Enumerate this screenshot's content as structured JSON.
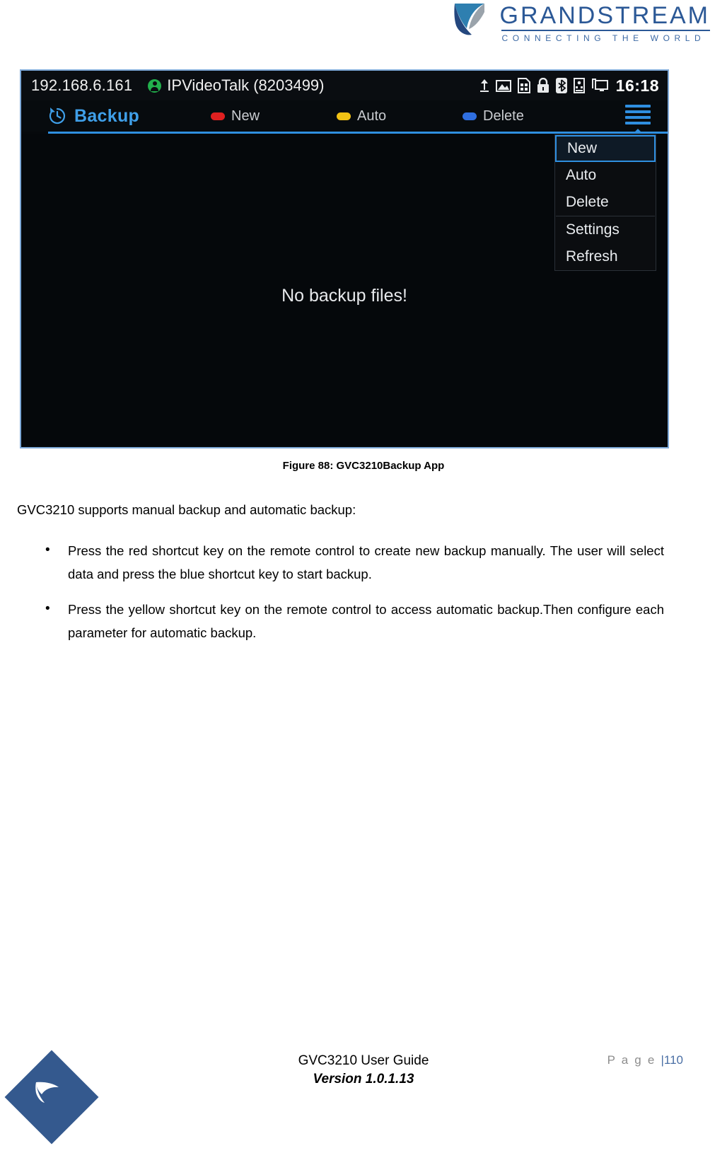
{
  "brand": {
    "name": "GRANDSTREAM",
    "tagline": "CONNECTING THE WORLD",
    "logo_icon": "grandstream-swoosh-icon",
    "primary_color": "#2b5896"
  },
  "screenshot": {
    "status_bar": {
      "ip_address": "192.168.6.161",
      "account_icon": "account-contact-icon",
      "account_label": "IPVideoTalk (8203499)",
      "icons": [
        "upload-icon",
        "picture-icon",
        "sd-card-icon",
        "lock-icon",
        "bluetooth-icon",
        "sim-card-icon",
        "display-monitor-icon"
      ],
      "clock": "16:18"
    },
    "app_bar": {
      "title_icon": "backup-restore-clock-icon",
      "title": "Backup",
      "softkeys": [
        {
          "label": "New",
          "color": "#e02020",
          "key": "red"
        },
        {
          "label": "Auto",
          "color": "#f2c214",
          "key": "yellow"
        },
        {
          "label": "Delete",
          "color": "#2f6fe0",
          "key": "blue"
        }
      ],
      "menu_icon": "hamburger-menu-icon"
    },
    "dropdown_menu": {
      "items": [
        {
          "label": "New",
          "selected": true
        },
        {
          "label": "Auto",
          "selected": false
        },
        {
          "label": "Delete",
          "selected": false
        },
        {
          "label": "Settings",
          "selected": false
        },
        {
          "label": "Refresh",
          "selected": false
        }
      ],
      "separator_after_index": 2
    },
    "content": {
      "empty_message": "No backup files!"
    },
    "accent_color": "#2f8fe0"
  },
  "figure": {
    "caption": "Figure 88: GVC3210Backup App"
  },
  "body": {
    "intro": "GVC3210 supports manual backup and automatic backup:",
    "bullets": [
      "Press the red shortcut key on the remote control to create new backup manually. The user will select data and press the blue shortcut key to start backup.",
      "Press the yellow shortcut key on the remote control to access automatic backup.Then configure each parameter for automatic backup."
    ]
  },
  "footer": {
    "guide_title": "GVC3210 User Guide",
    "version": "Version 1.0.1.13",
    "page_label": "P a g e ",
    "page_separator": "|",
    "page_number": "110",
    "logo_icon": "grandstream-diamond-logo-icon"
  }
}
